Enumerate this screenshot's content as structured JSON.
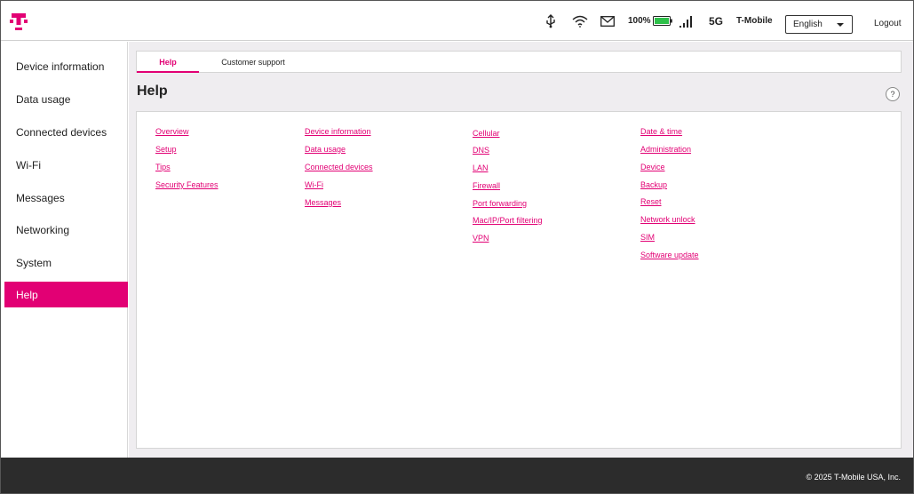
{
  "header": {
    "battery_text": "100%",
    "network_type": "5G",
    "carrier": "T-Mobile",
    "language_selected": "English",
    "logout_label": "Logout",
    "brand_color": "#e20074",
    "battery_color": "#2ec04a",
    "status_icons": [
      "usb-icon",
      "wifi-icon",
      "mail-icon",
      "battery-icon",
      "signal-icon"
    ]
  },
  "sidebar": {
    "items": [
      {
        "label": "Device information"
      },
      {
        "label": "Data usage"
      },
      {
        "label": "Connected devices"
      },
      {
        "label": "Wi-Fi"
      },
      {
        "label": "Messages"
      },
      {
        "label": "Networking"
      },
      {
        "label": "System"
      },
      {
        "label": "Help"
      }
    ],
    "active_index": 7
  },
  "main": {
    "tabs": [
      {
        "label": "Help"
      },
      {
        "label": "Customer support"
      }
    ],
    "title": "Help",
    "help_button": "?",
    "columns": [
      [
        "Overview",
        "Setup",
        "Tips",
        "Security Features"
      ],
      [
        "Device information",
        "Data usage",
        "Connected devices",
        "Wi-Fi",
        "Messages"
      ],
      [
        "Cellular",
        "DNS",
        "LAN",
        "Firewall",
        "Port forwarding",
        "Mac/IP/Port filtering",
        "VPN"
      ],
      [
        "Date & time",
        "Administration",
        "Device",
        "Backup",
        "Reset",
        "Network unlock",
        "SIM",
        "Software update"
      ]
    ]
  },
  "footer": {
    "copyright": "© 2025 T-Mobile USA, Inc."
  }
}
